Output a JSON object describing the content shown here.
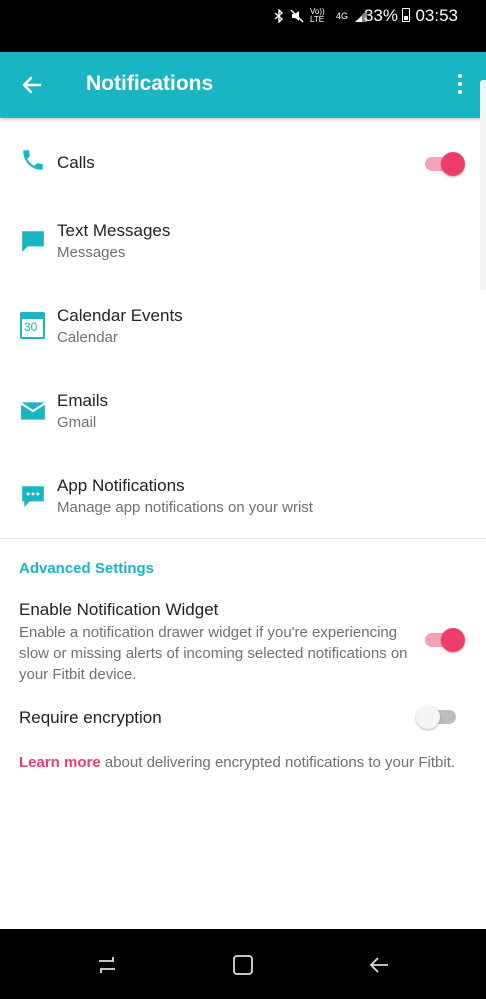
{
  "status_bar": {
    "network": "4G",
    "volte": "Vo)) LTE",
    "battery": "33%",
    "time": "03:53"
  },
  "app_bar": {
    "title": "Notifications"
  },
  "notifications": [
    {
      "id": "calls",
      "icon": "phone-icon",
      "label": "Calls",
      "sub": "",
      "toggle": true
    },
    {
      "id": "text-messages",
      "icon": "message-icon",
      "label": "Text Messages",
      "sub": "Messages"
    },
    {
      "id": "calendar-events",
      "icon": "calendar-icon",
      "label": "Calendar Events",
      "sub": "Calendar",
      "calendar_day": "30"
    },
    {
      "id": "emails",
      "icon": "envelope-icon",
      "label": "Emails",
      "sub": "Gmail"
    },
    {
      "id": "app-notifications",
      "icon": "chat-dots-icon",
      "label": "App Notifications",
      "sub": "Manage app notifications on your wrist"
    }
  ],
  "advanced": {
    "title": "Advanced Settings",
    "widget_label": "Enable Notification Widget",
    "widget_desc": "Enable a notification drawer widget if you're experiencing slow or missing alerts of incoming selected notifications on your Fitbit device.",
    "widget_enabled": true,
    "encryption_label": "Require encryption",
    "encryption_enabled": false,
    "learn_link": "Learn more",
    "learn_text": " about delivering encrypted notifications to your Fitbit."
  },
  "colors": {
    "accent": "#1ab5c3",
    "toggle_on": "#ee3d69",
    "link": "#e8406d"
  }
}
